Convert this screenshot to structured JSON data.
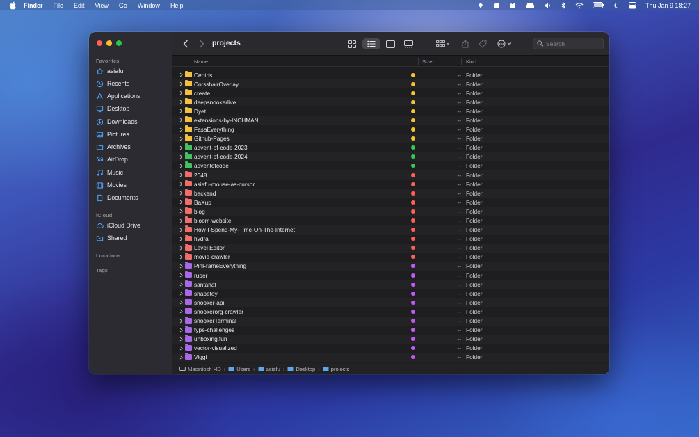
{
  "menubar": {
    "app_name": "Finder",
    "menus": [
      "File",
      "Edit",
      "View",
      "Go",
      "Window",
      "Help"
    ],
    "status_icons": [
      "pin-icon",
      "mailbox-icon",
      "cat-icon",
      "tray-icon",
      "volume-icon",
      "bluetooth-icon",
      "wifi-icon",
      "battery-icon",
      "moon-icon",
      "control-center-icon"
    ],
    "clock": "Thu Jan 9  18:27"
  },
  "sidebar": {
    "favorites_heading": "Favorites",
    "favorites": [
      {
        "label": "asiafu",
        "icon": "home-icon"
      },
      {
        "label": "Recents",
        "icon": "clock-icon"
      },
      {
        "label": "Applications",
        "icon": "applications-icon"
      },
      {
        "label": "Desktop",
        "icon": "desktop-icon"
      },
      {
        "label": "Downloads",
        "icon": "download-icon"
      },
      {
        "label": "Pictures",
        "icon": "photo-icon"
      },
      {
        "label": "Archives",
        "icon": "folder-icon"
      },
      {
        "label": "AirDrop",
        "icon": "airdrop-icon"
      },
      {
        "label": "Music",
        "icon": "music-icon"
      },
      {
        "label": "Movies",
        "icon": "film-icon"
      },
      {
        "label": "Documents",
        "icon": "document-icon"
      }
    ],
    "icloud_heading": "iCloud",
    "icloud": [
      {
        "label": "iCloud Drive",
        "icon": "cloud-icon"
      },
      {
        "label": "Shared",
        "icon": "shared-folder-icon"
      }
    ],
    "locations_heading": "Locations",
    "tags_heading": "Tags"
  },
  "toolbar": {
    "title": "projects",
    "search_placeholder": "Search"
  },
  "columns": {
    "name": "Name",
    "size": "Size",
    "kind": "Kind"
  },
  "tag_colors": {
    "yellow": "#f4c430",
    "green": "#34c759",
    "red": "#ff5f57",
    "purple": "#bf5af2"
  },
  "folder_colors": {
    "yellow": "#f3c042",
    "green": "#42c163",
    "red": "#ef6d6a",
    "purple": "#a969e6"
  },
  "files": [
    {
      "name": "Centris",
      "tag": "yellow",
      "size": "--",
      "kind": "Folder"
    },
    {
      "name": "CorsshairOverlay",
      "tag": "yellow",
      "size": "--",
      "kind": "Folder"
    },
    {
      "name": "create",
      "tag": "yellow",
      "size": "--",
      "kind": "Folder"
    },
    {
      "name": "deepsnookerlive",
      "tag": "yellow",
      "size": "--",
      "kind": "Folder"
    },
    {
      "name": "Dyet",
      "tag": "yellow",
      "size": "--",
      "kind": "Folder"
    },
    {
      "name": "extensions-by-INCHMAN",
      "tag": "yellow",
      "size": "--",
      "kind": "Folder"
    },
    {
      "name": "FasaEverything",
      "tag": "yellow",
      "size": "--",
      "kind": "Folder"
    },
    {
      "name": "Github-Pages",
      "tag": "yellow",
      "size": "--",
      "kind": "Folder"
    },
    {
      "name": "advent-of-code-2023",
      "tag": "green",
      "size": "--",
      "kind": "Folder"
    },
    {
      "name": "advent-of-code-2024",
      "tag": "green",
      "size": "--",
      "kind": "Folder"
    },
    {
      "name": "adventofcode",
      "tag": "green",
      "size": "--",
      "kind": "Folder"
    },
    {
      "name": "2048",
      "tag": "red",
      "size": "--",
      "kind": "Folder"
    },
    {
      "name": "asiafu-mouse-as-cursor",
      "tag": "red",
      "size": "--",
      "kind": "Folder"
    },
    {
      "name": "backend",
      "tag": "red",
      "size": "--",
      "kind": "Folder"
    },
    {
      "name": "BaXup",
      "tag": "red",
      "size": "--",
      "kind": "Folder"
    },
    {
      "name": "blog",
      "tag": "red",
      "size": "--",
      "kind": "Folder"
    },
    {
      "name": "bloom-website",
      "tag": "red",
      "size": "--",
      "kind": "Folder"
    },
    {
      "name": "How-I-Spend-My-Time-On-The-Internet",
      "tag": "red",
      "size": "--",
      "kind": "Folder"
    },
    {
      "name": "hydra",
      "tag": "red",
      "size": "--",
      "kind": "Folder"
    },
    {
      "name": "Level Editor",
      "tag": "red",
      "size": "--",
      "kind": "Folder"
    },
    {
      "name": "movie-crawler",
      "tag": "red",
      "size": "--",
      "kind": "Folder"
    },
    {
      "name": "PinFrameEverything",
      "tag": "purple",
      "size": "--",
      "kind": "Folder"
    },
    {
      "name": "ruper",
      "tag": "purple",
      "size": "--",
      "kind": "Folder"
    },
    {
      "name": "santahat",
      "tag": "purple",
      "size": "--",
      "kind": "Folder"
    },
    {
      "name": "shapetoy",
      "tag": "purple",
      "size": "--",
      "kind": "Folder"
    },
    {
      "name": "snooker-api",
      "tag": "purple",
      "size": "--",
      "kind": "Folder"
    },
    {
      "name": "snookerorg-crawler",
      "tag": "purple",
      "size": "--",
      "kind": "Folder"
    },
    {
      "name": "snookerTerminal",
      "tag": "purple",
      "size": "--",
      "kind": "Folder"
    },
    {
      "name": "type-challenges",
      "tag": "purple",
      "size": "--",
      "kind": "Folder"
    },
    {
      "name": "unboxing.fun",
      "tag": "purple",
      "size": "--",
      "kind": "Folder"
    },
    {
      "name": "vector-visualized",
      "tag": "purple",
      "size": "--",
      "kind": "Folder"
    },
    {
      "name": "Viggi",
      "tag": "purple",
      "size": "--",
      "kind": "Folder"
    }
  ],
  "pathbar": [
    {
      "label": "Macintosh HD",
      "icon": "disk-icon"
    },
    {
      "label": "Users",
      "icon": "folder-icon"
    },
    {
      "label": "asiafu",
      "icon": "folder-icon"
    },
    {
      "label": "Desktop",
      "icon": "folder-icon"
    },
    {
      "label": "projects",
      "icon": "folder-icon"
    }
  ],
  "pathbar_separator": "›"
}
